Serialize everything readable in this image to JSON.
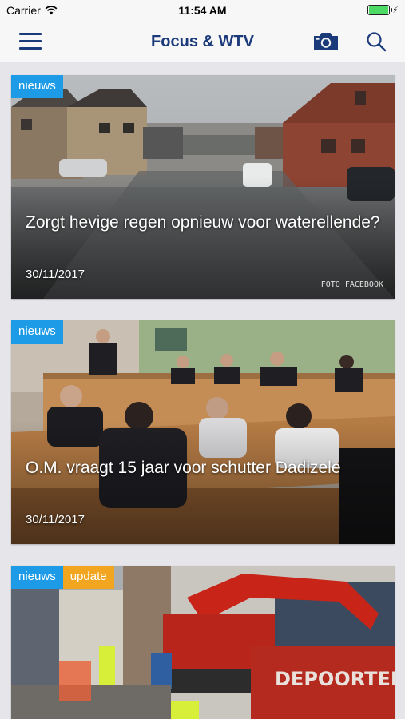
{
  "status_bar": {
    "carrier": "Carrier",
    "time": "11:54 AM"
  },
  "nav": {
    "title": "Focus & WTV",
    "icons": [
      "menu-icon",
      "camera-icon",
      "search-icon"
    ]
  },
  "colors": {
    "brand": "#1a3a7a",
    "tag_news": "#1d9be6",
    "tag_update": "#f2a51f"
  },
  "articles": [
    {
      "tags": [
        "nieuws"
      ],
      "title": "Zorgt hevige regen opnieuw voor waterellende?",
      "date": "30/11/2017",
      "photo_credit": "FOTO FACEBOOK"
    },
    {
      "tags": [
        "nieuws"
      ],
      "title": "O.M. vraagt 15 jaar voor schutter Dadizele",
      "date": "30/11/2017"
    },
    {
      "tags": [
        "nieuws",
        "update"
      ],
      "image_text": "DEPOORTER"
    }
  ]
}
